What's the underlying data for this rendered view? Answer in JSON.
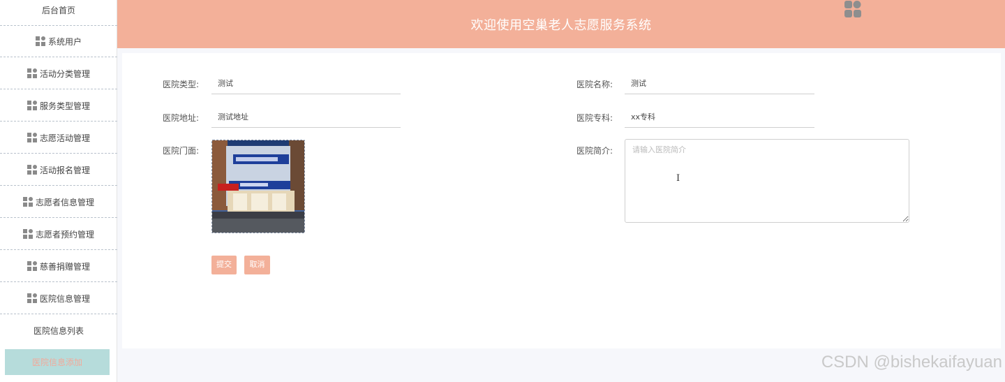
{
  "sidebar": {
    "items": [
      {
        "label": "后台首页",
        "icon": "none"
      },
      {
        "label": "系统用户",
        "icon": "grid-icon"
      },
      {
        "label": "活动分类管理",
        "icon": "grid-icon"
      },
      {
        "label": "服务类型管理",
        "icon": "grid-icon"
      },
      {
        "label": "志愿活动管理",
        "icon": "grid-icon"
      },
      {
        "label": "活动报名管理",
        "icon": "grid-icon"
      },
      {
        "label": "志愿者信息管理",
        "icon": "grid-icon"
      },
      {
        "label": "志愿者预约管理",
        "icon": "grid-icon"
      },
      {
        "label": "慈善捐赠管理",
        "icon": "grid-icon"
      },
      {
        "label": "医院信息管理",
        "icon": "grid-icon"
      }
    ],
    "sub_items": [
      {
        "label": "医院信息列表"
      },
      {
        "label": "医院信息添加"
      }
    ]
  },
  "header": {
    "title": "欢迎使用空巢老人志愿服务系统"
  },
  "form": {
    "hospital_type": {
      "label": "医院类型:",
      "value": "测试"
    },
    "hospital_name": {
      "label": "医院名称:",
      "value": "测试"
    },
    "hospital_address": {
      "label": "医院地址:",
      "value": "测试地址"
    },
    "hospital_department": {
      "label": "医院专科:",
      "value": "xx专科"
    },
    "hospital_facade": {
      "label": "医院门面:"
    },
    "hospital_intro": {
      "label": "医院简介:",
      "placeholder": "请输入医院简介"
    },
    "submit_label": "提交",
    "cancel_label": "取消"
  },
  "watermark": "CSDN @bishekaifayuan",
  "colors": {
    "header": "#f3b099",
    "active_item": "#b6dcdb",
    "button": "#f3b099"
  }
}
